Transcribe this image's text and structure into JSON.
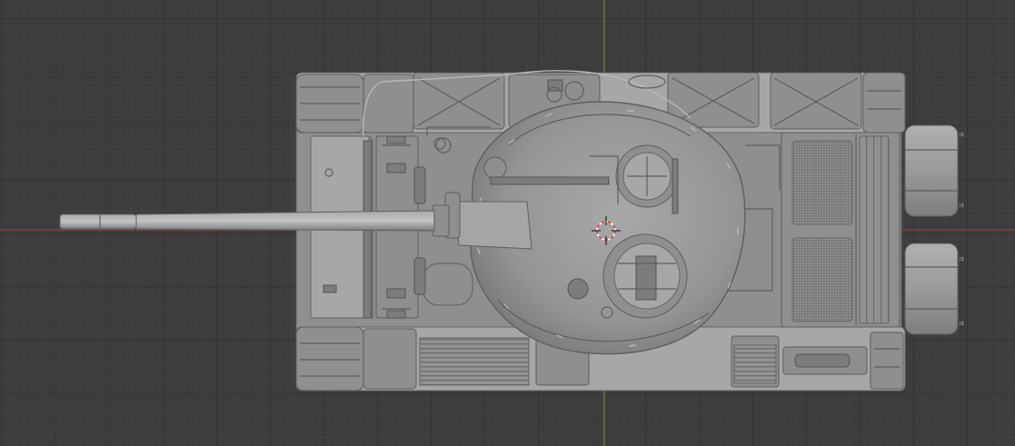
{
  "app": "3D viewport",
  "scene": {
    "object": "tank-model-top-view",
    "shading": "solid",
    "colors": {
      "background": "#3d3d3d",
      "grid_major": "#2e2e2e",
      "x_axis": "#9a3b3b",
      "y_axis": "#5f8d2e",
      "model": "#8f8f8f",
      "cursor_red": "#d64040",
      "cursor_white": "#ffffff"
    },
    "cursor_icon": "3d-cursor-icon"
  }
}
